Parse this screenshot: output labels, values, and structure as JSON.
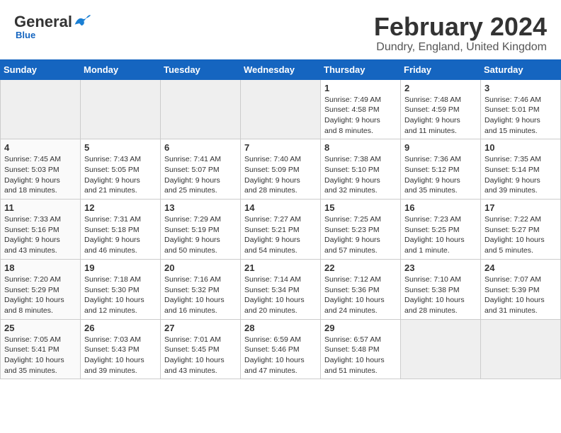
{
  "header": {
    "logo_general": "General",
    "logo_blue": "Blue",
    "month_title": "February 2024",
    "location": "Dundry, England, United Kingdom"
  },
  "columns": [
    "Sunday",
    "Monday",
    "Tuesday",
    "Wednesday",
    "Thursday",
    "Friday",
    "Saturday"
  ],
  "weeks": [
    [
      {
        "day": "",
        "info": ""
      },
      {
        "day": "",
        "info": ""
      },
      {
        "day": "",
        "info": ""
      },
      {
        "day": "",
        "info": ""
      },
      {
        "day": "1",
        "info": "Sunrise: 7:49 AM\nSunset: 4:58 PM\nDaylight: 9 hours\nand 8 minutes."
      },
      {
        "day": "2",
        "info": "Sunrise: 7:48 AM\nSunset: 4:59 PM\nDaylight: 9 hours\nand 11 minutes."
      },
      {
        "day": "3",
        "info": "Sunrise: 7:46 AM\nSunset: 5:01 PM\nDaylight: 9 hours\nand 15 minutes."
      }
    ],
    [
      {
        "day": "4",
        "info": "Sunrise: 7:45 AM\nSunset: 5:03 PM\nDaylight: 9 hours\nand 18 minutes."
      },
      {
        "day": "5",
        "info": "Sunrise: 7:43 AM\nSunset: 5:05 PM\nDaylight: 9 hours\nand 21 minutes."
      },
      {
        "day": "6",
        "info": "Sunrise: 7:41 AM\nSunset: 5:07 PM\nDaylight: 9 hours\nand 25 minutes."
      },
      {
        "day": "7",
        "info": "Sunrise: 7:40 AM\nSunset: 5:09 PM\nDaylight: 9 hours\nand 28 minutes."
      },
      {
        "day": "8",
        "info": "Sunrise: 7:38 AM\nSunset: 5:10 PM\nDaylight: 9 hours\nand 32 minutes."
      },
      {
        "day": "9",
        "info": "Sunrise: 7:36 AM\nSunset: 5:12 PM\nDaylight: 9 hours\nand 35 minutes."
      },
      {
        "day": "10",
        "info": "Sunrise: 7:35 AM\nSunset: 5:14 PM\nDaylight: 9 hours\nand 39 minutes."
      }
    ],
    [
      {
        "day": "11",
        "info": "Sunrise: 7:33 AM\nSunset: 5:16 PM\nDaylight: 9 hours\nand 43 minutes."
      },
      {
        "day": "12",
        "info": "Sunrise: 7:31 AM\nSunset: 5:18 PM\nDaylight: 9 hours\nand 46 minutes."
      },
      {
        "day": "13",
        "info": "Sunrise: 7:29 AM\nSunset: 5:19 PM\nDaylight: 9 hours\nand 50 minutes."
      },
      {
        "day": "14",
        "info": "Sunrise: 7:27 AM\nSunset: 5:21 PM\nDaylight: 9 hours\nand 54 minutes."
      },
      {
        "day": "15",
        "info": "Sunrise: 7:25 AM\nSunset: 5:23 PM\nDaylight: 9 hours\nand 57 minutes."
      },
      {
        "day": "16",
        "info": "Sunrise: 7:23 AM\nSunset: 5:25 PM\nDaylight: 10 hours\nand 1 minute."
      },
      {
        "day": "17",
        "info": "Sunrise: 7:22 AM\nSunset: 5:27 PM\nDaylight: 10 hours\nand 5 minutes."
      }
    ],
    [
      {
        "day": "18",
        "info": "Sunrise: 7:20 AM\nSunset: 5:29 PM\nDaylight: 10 hours\nand 8 minutes."
      },
      {
        "day": "19",
        "info": "Sunrise: 7:18 AM\nSunset: 5:30 PM\nDaylight: 10 hours\nand 12 minutes."
      },
      {
        "day": "20",
        "info": "Sunrise: 7:16 AM\nSunset: 5:32 PM\nDaylight: 10 hours\nand 16 minutes."
      },
      {
        "day": "21",
        "info": "Sunrise: 7:14 AM\nSunset: 5:34 PM\nDaylight: 10 hours\nand 20 minutes."
      },
      {
        "day": "22",
        "info": "Sunrise: 7:12 AM\nSunset: 5:36 PM\nDaylight: 10 hours\nand 24 minutes."
      },
      {
        "day": "23",
        "info": "Sunrise: 7:10 AM\nSunset: 5:38 PM\nDaylight: 10 hours\nand 28 minutes."
      },
      {
        "day": "24",
        "info": "Sunrise: 7:07 AM\nSunset: 5:39 PM\nDaylight: 10 hours\nand 31 minutes."
      }
    ],
    [
      {
        "day": "25",
        "info": "Sunrise: 7:05 AM\nSunset: 5:41 PM\nDaylight: 10 hours\nand 35 minutes."
      },
      {
        "day": "26",
        "info": "Sunrise: 7:03 AM\nSunset: 5:43 PM\nDaylight: 10 hours\nand 39 minutes."
      },
      {
        "day": "27",
        "info": "Sunrise: 7:01 AM\nSunset: 5:45 PM\nDaylight: 10 hours\nand 43 minutes."
      },
      {
        "day": "28",
        "info": "Sunrise: 6:59 AM\nSunset: 5:46 PM\nDaylight: 10 hours\nand 47 minutes."
      },
      {
        "day": "29",
        "info": "Sunrise: 6:57 AM\nSunset: 5:48 PM\nDaylight: 10 hours\nand 51 minutes."
      },
      {
        "day": "",
        "info": ""
      },
      {
        "day": "",
        "info": ""
      }
    ]
  ]
}
